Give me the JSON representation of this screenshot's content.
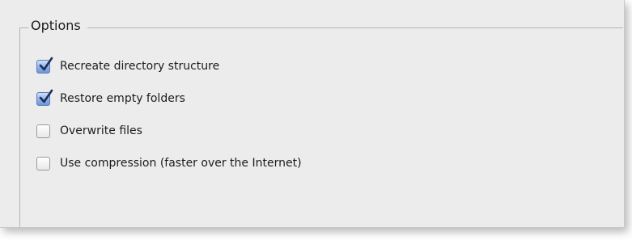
{
  "group": {
    "title": "Options"
  },
  "options": [
    {
      "label": "Recreate directory structure",
      "checked": true
    },
    {
      "label": "Restore empty folders",
      "checked": true
    },
    {
      "label": "Overwrite files",
      "checked": false
    },
    {
      "label": "Use compression (faster over the Internet)",
      "checked": false
    }
  ],
  "colors": {
    "check_accent": "#6f96d9",
    "panel_bg": "#ececec"
  }
}
